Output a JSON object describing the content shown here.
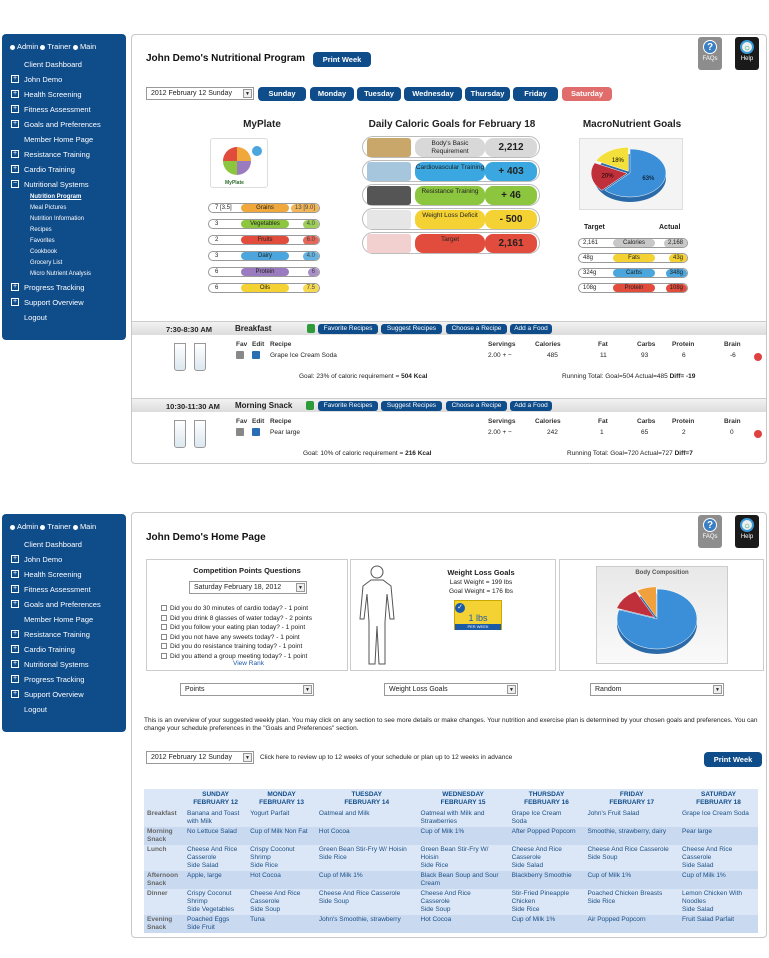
{
  "nav_top": {
    "admin": "Admin",
    "trainer": "Trainer",
    "main": "Main"
  },
  "nav1": [
    {
      "label": "Client Dashboard",
      "pm": ""
    },
    {
      "label": "John Demo",
      "pm": "+"
    },
    {
      "label": "Health Screening",
      "pm": "+"
    },
    {
      "label": "Fitness Assessment",
      "pm": "+"
    },
    {
      "label": "Goals and Preferences",
      "pm": "+"
    },
    {
      "label": "Member Home Page",
      "pm": ""
    },
    {
      "label": "Resistance Training",
      "pm": "+"
    },
    {
      "label": "Cardio Training",
      "pm": "+"
    },
    {
      "label": "Nutritional Systems",
      "pm": "−"
    }
  ],
  "nav1_sub": [
    "Nutrition Program",
    "Meal Pictures",
    "Nutrition Information",
    "Recipes",
    "Favorites",
    "Cookbook",
    "Grocery List",
    "Micro Nutrient Analysis"
  ],
  "nav1_after": [
    {
      "label": "Progress Tracking",
      "pm": "+"
    },
    {
      "label": "Support Overview",
      "pm": "+"
    },
    {
      "label": "Logout",
      "pm": ""
    }
  ],
  "nav2": [
    {
      "label": "Client Dashboard",
      "pm": ""
    },
    {
      "label": "John Demo",
      "pm": "+"
    },
    {
      "label": "Health Screening",
      "pm": "+"
    },
    {
      "label": "Fitness Assessment",
      "pm": "+"
    },
    {
      "label": "Goals and Preferences",
      "pm": "+"
    },
    {
      "label": "Member Home Page",
      "pm": ""
    },
    {
      "label": "Resistance Training",
      "pm": "+"
    },
    {
      "label": "Cardio Training",
      "pm": "+"
    },
    {
      "label": "Nutritional Systems",
      "pm": "+"
    },
    {
      "label": "Progress Tracking",
      "pm": "+"
    },
    {
      "label": "Support Overview",
      "pm": "+"
    },
    {
      "label": "Logout",
      "pm": ""
    }
  ],
  "icons": {
    "faqs": "FAQs",
    "help": "Help"
  },
  "nutrition": {
    "title": "John Demo's Nutritional Program",
    "print_week": "Print Week",
    "date_select": "2012 February 12 Sunday",
    "days": [
      "Sunday",
      "Monday",
      "Tuesday",
      "Wednesday",
      "Thursday",
      "Friday",
      "Saturday"
    ],
    "myplate_title": "MyPlate",
    "myplate_logo": "MyPlate",
    "myplate": [
      {
        "left": "7 [3.5]",
        "name": "Grains",
        "right": "13 [9.0]",
        "color": "#f0a83c"
      },
      {
        "left": "3",
        "name": "Vegetables",
        "right": "4.0",
        "color": "#8cc63e"
      },
      {
        "left": "2",
        "name": "Fruits",
        "right": "6.0",
        "color": "#e24c3c"
      },
      {
        "left": "3",
        "name": "Dairy",
        "right": "4.0",
        "color": "#4aa6dc"
      },
      {
        "left": "6",
        "name": "Protein",
        "right": "6",
        "color": "#9b7bbf"
      },
      {
        "left": "6",
        "name": "Oils",
        "right": "7.5",
        "color": "#f5d233"
      }
    ],
    "caloric_title": "Daily Caloric Goals for February 18",
    "caloric": [
      {
        "label": "Body's Basic Requirement",
        "value": "2,212",
        "color": "#d8d8d8",
        "img": "#c9a76a"
      },
      {
        "label": "Cardiovascular Training",
        "value": "+ 403",
        "color": "#3aa7e0",
        "img": "#a6c6de"
      },
      {
        "label": "Resistance Training",
        "value": "+ 46",
        "color": "#8cc63e",
        "img": "#555"
      },
      {
        "label": "Weight Loss Deficit",
        "value": "- 500",
        "color": "#f5d233",
        "img": "#e6e6e6"
      },
      {
        "label": "Target",
        "value": "2,161",
        "color": "#e24c3c",
        "img": "#f3d0d0"
      }
    ],
    "macro_title": "MacroNutrient Goals",
    "macro_pie": [
      {
        "label": "63%",
        "value": 63,
        "color": "#3a8fd8"
      },
      {
        "label": "20%",
        "value": 20,
        "color": "#c0303a"
      },
      {
        "label": "18%",
        "value": 18,
        "color": "#f3e03a"
      }
    ],
    "macro_target_label": "Target",
    "macro_actual_label": "Actual",
    "macros": [
      {
        "target": "2,161",
        "name": "Calories",
        "actual": "2,168",
        "color": "#c8c8c8"
      },
      {
        "target": "48g",
        "name": "Fats",
        "actual": "43g",
        "color": "#f5d233"
      },
      {
        "target": "324g",
        "name": "Carbs",
        "actual": "348g",
        "color": "#4aa6dc"
      },
      {
        "target": "108g",
        "name": "Protein",
        "actual": "108g",
        "color": "#e24c3c"
      }
    ],
    "meal_buttons": [
      "Favorite Recipes",
      "Suggest Recipes",
      "Choose a Recipe",
      "Add a Food"
    ],
    "col_headers": {
      "fav": "Fav",
      "edit": "Edit",
      "recipe": "Recipe",
      "servings": "Servings",
      "calories": "Calories",
      "fat": "Fat",
      "carbs": "Carbs",
      "protein": "Protein",
      "brain": "Brain"
    },
    "meals": [
      {
        "time": "7:30-8:30 AM",
        "name": "Breakfast",
        "recipe": "Grape Ice Cream Soda",
        "servings": "2.00 + −",
        "calories": "485",
        "fat": "11",
        "carbs": "93",
        "protein": "6",
        "brain": "-6",
        "goal_prefix": "Goal: 23% of caloric requirement = ",
        "goal_kcal": "504 Kcal",
        "running_prefix": "Running Total: Goal=504 Actual=485 ",
        "running_diff": "Diff= -19"
      },
      {
        "time": "10:30-11:30 AM",
        "name": "Morning Snack",
        "recipe": "Pear large",
        "servings": "2.00 + −",
        "calories": "242",
        "fat": "1",
        "carbs": "65",
        "protein": "2",
        "brain": "0",
        "goal_prefix": "Goal: 10% of caloric requirement = ",
        "goal_kcal": "216 Kcal",
        "running_prefix": "Running Total: Goal=720 Actual=727 ",
        "running_diff": "Diff=7"
      }
    ]
  },
  "home": {
    "title": "John Demo's Home Page",
    "competition_title": "Competition Points Questions",
    "competition_date": "Saturday February 18, 2012",
    "questions": [
      "Did you do 30 minutes of cardio today? - 1 point",
      "Did you drink 8 glasses of water today? - 2 points",
      "Did you follow your eating plan today? - 1 point",
      "Did you not have any sweets today? - 1 point",
      "Did you do resistance training today? - 1 point",
      "Did you attend a group meeting today? - 1 point"
    ],
    "view_rank": "View Rank",
    "wl_title": "Weight Loss Goals",
    "last_weight": "Last Weight = 199 lbs",
    "goal_weight": "Goal Weight = 176 lbs",
    "badge": "1 lbs",
    "badge_sub": "PER WEEK",
    "body_comp_title": "Body Composition",
    "body_comp_pie": [
      {
        "value": 80,
        "color": "#3a8fd8"
      },
      {
        "value": 12,
        "color": "#c0303a"
      },
      {
        "value": 8,
        "color": "#f0a03c"
      }
    ],
    "dropdowns": [
      "Points",
      "Weight Loss Goals",
      "Random"
    ],
    "overview": "This is an overview of your suggested weekly plan. You may click on any section to see more details or make changes. Your nutrition and exercise plan is determined by your chosen goals and preferences. You can change your schedule preferences in the \"Goals and Preferences\" section.",
    "week_select": "2012 February 12 Sunday",
    "week_hint": "Click here to review up to 12 weeks of your schedule or plan up to 12 weeks in advance",
    "print_week": "Print Week",
    "plan": {
      "days": [
        {
          "day": "SUNDAY",
          "date": "FEBRUARY 12"
        },
        {
          "day": "MONDAY",
          "date": "FEBRUARY 13"
        },
        {
          "day": "TUESDAY",
          "date": "FEBRUARY 14"
        },
        {
          "day": "WEDNESDAY",
          "date": "FEBRUARY 15"
        },
        {
          "day": "THURSDAY",
          "date": "FEBRUARY 16"
        },
        {
          "day": "FRIDAY",
          "date": "FEBRUARY 17"
        },
        {
          "day": "SATURDAY",
          "date": "FEBRUARY 18"
        }
      ],
      "rows": [
        {
          "label": "Breakfast",
          "cells": [
            "Banana and Toast\nwith Milk",
            "Yogurt Parfait",
            "Oatmeal and Milk",
            "Oatmeal with Milk and\nStrawberries",
            "Grape Ice Cream\nSoda",
            "John's Fruit Salad",
            "Grape Ice Cream Soda"
          ]
        },
        {
          "label": "Morning\nSnack",
          "cells": [
            "No Lettuce Salad",
            "Cup of Milk Non Fat",
            "Hot Cocoa",
            "Cup of Milk 1%",
            "After Popped Popcorn",
            "Smoothie, strawberry, dairy",
            "Pear large"
          ]
        },
        {
          "label": "Lunch",
          "cells": [
            "Cheese And Rice\nCasserole\nSide Salad",
            "Crispy Coconut\nShrimp\nSide Rice",
            "Green Bean Stir-Fry W/ Hoisin\nSide Rice",
            "Green Bean Stir-Fry W/\nHoisin\nSide Rice",
            "Cheese And Rice\nCasserole\nSide Salad",
            "Cheese And Rice Casserole\nSide Soup",
            "Cheese And Rice\nCasserole\nSide Salad"
          ]
        },
        {
          "label": "Afternoon\nSnack",
          "cells": [
            "Apple, large",
            "Hot Cocoa",
            "Cup of Milk 1%",
            "Black Bean Soup and Sour\nCream",
            "Blackberry Smoothie",
            "Cup of Milk 1%",
            "Cup of Milk 1%"
          ]
        },
        {
          "label": "Dinner",
          "cells": [
            "Crispy Coconut\nShrimp\nSide Vegetables",
            "Cheese And Rice\nCasserole\nSide Soup",
            "Cheese And Rice Casserole\nSide Soup",
            "Cheese And Rice\nCasserole\nSide Soup",
            "Stir-Fried Pineapple\nChicken\nSide Rice",
            "Poached Chicken Breasts\nSide Rice",
            "Lemon Chicken With\nNoodles\nSide Salad"
          ]
        },
        {
          "label": "Evening\nSnack",
          "cells": [
            "Poached Eggs\nSide Fruit",
            "Tuna",
            "John's Smoothie, strawberry",
            "Hot Cocoa",
            "Cup of Milk 1%",
            "Air Popped Popcorn",
            "Fruit Salad Parfait"
          ]
        }
      ]
    }
  }
}
